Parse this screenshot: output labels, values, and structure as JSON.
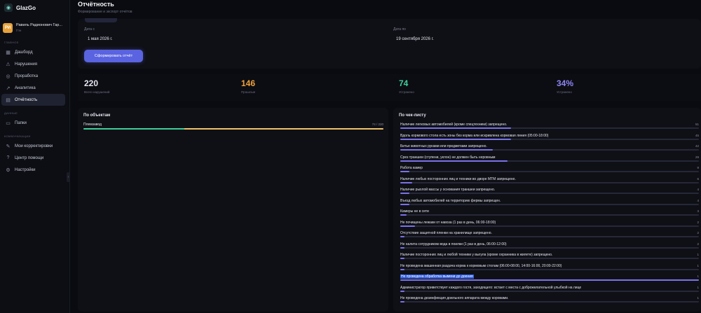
{
  "brand": {
    "name": "GlazGo",
    "logo_icon": "eye-logo-icon"
  },
  "user": {
    "initials": "РИ",
    "name": "Равиль Радионович Гар...",
    "role": "Гпн"
  },
  "sidebar": {
    "sections": [
      {
        "label": "ГЛАВНОЕ",
        "items": [
          {
            "label": "Дашборд",
            "icon": "grid-icon",
            "active": false
          },
          {
            "label": "Нарушения",
            "icon": "warning-icon",
            "active": false
          },
          {
            "label": "Проработка",
            "icon": "check-circle-icon",
            "active": false
          },
          {
            "label": "Аналитика",
            "icon": "chart-icon",
            "active": false
          },
          {
            "label": "Отчётность",
            "icon": "report-icon",
            "active": true
          }
        ]
      },
      {
        "label": "ДАННЫЕ",
        "items": [
          {
            "label": "Папки",
            "icon": "folder-icon",
            "active": false
          }
        ]
      },
      {
        "label": "КОММУНИКАЦИИ",
        "items": [
          {
            "label": "Мои корректировки",
            "icon": "edit-icon",
            "active": false
          },
          {
            "label": "Центр помощи",
            "icon": "help-icon",
            "active": false
          },
          {
            "label": "Настройки",
            "icon": "gear-icon",
            "active": false
          }
        ]
      }
    ]
  },
  "page": {
    "title": "Отчётность",
    "subtitle": "Формирование и экспорт отчётов"
  },
  "filters": {
    "from_label": "Дата с",
    "from_value": "1 мая 2026 г.",
    "to_label": "Дата по",
    "to_value": "19 сентября 2026 г.",
    "generate_button": "Сформировать отчёт"
  },
  "stats": [
    {
      "value": "220",
      "label": "Всего нарушений",
      "color": "#e4e6ef"
    },
    {
      "value": "146",
      "label": "Прошлые",
      "color": "#f0a23a"
    },
    {
      "value": "74",
      "label": "Устранено",
      "color": "#3ecf9a"
    },
    {
      "value": "34%",
      "label": "Устранено",
      "color": "#8e85f5"
    }
  ],
  "objects": {
    "title": "По объектам",
    "rows": [
      {
        "name": "Племзавод",
        "count": "74 / 220",
        "share_resolved": 0.336,
        "share_pending": 0.664
      }
    ]
  },
  "checklist": {
    "title": "По чек-листу",
    "rows": [
      {
        "text": "Наличие легковых автомобилей (кроме спецтехники) запрещено.",
        "count": "51",
        "fraction": 0.37
      },
      {
        "text": "Вдоль кормового стола есть зоны без корма или искривлена кормовая линия (05:00-18:00)",
        "count": "45",
        "fraction": 0.37
      },
      {
        "text": "Битье животных руками или предметами запрещено.",
        "count": "42",
        "fraction": 0.31
      },
      {
        "text": "Срез траншеи (ступени, уклон) не должен быть неровным",
        "count": "29",
        "fraction": 0.36
      },
      {
        "text": "Работа камер",
        "count": "9",
        "fraction": 0.03
      },
      {
        "text": "Наличие любых посторонних лиц и техники во дворе МТМ запрещено.",
        "count": "6",
        "fraction": 0.04
      },
      {
        "text": "Наличие рыхлой массы у основания траншеи запрещено.",
        "count": "4",
        "fraction": 0.03
      },
      {
        "text": "Въезд любых автомобилей на территорию фермы запрещен.",
        "count": "4",
        "fraction": 0.03
      },
      {
        "text": "Камеры не в сети",
        "count": "3",
        "fraction": 0.02
      },
      {
        "text": "Не почищены лежаки от навоза (1 раз в день, 06:00-18:00)",
        "count": "2",
        "fraction": 0.05
      },
      {
        "text": "Отсутствие защитной пленки на хранилище запрещено.",
        "count": "2",
        "fraction": 0.015
      },
      {
        "text": "Не налита сотрудником вода в поилки (1 раз в день, 06:00-12:00)",
        "count": "2",
        "fraction": 0.015
      },
      {
        "text": "Наличие посторонних лиц и любой техники у выгула (кроме охранника в жилете) запрещено.",
        "count": "1",
        "fraction": 0.015
      },
      {
        "text": "Не проведена машинная раздача корма к кормовым столам (06:00-08:00, 14:00-16:00, 20:00-22:00)",
        "count": "1",
        "fraction": 0.015
      },
      {
        "text": "Не проведена обработка вымени до доения",
        "count": "1",
        "fraction": 1.0,
        "highlight": true
      },
      {
        "text": "Администратор приветствует каждого гостя, заходящего: встает с места с доброжелательной улыбкой на лице",
        "count": "1",
        "fraction": 0.015
      },
      {
        "text": "Не проведена дезинфекция доильного аппарата между коровами.",
        "count": "1",
        "fraction": 0.015
      }
    ]
  },
  "colors": {
    "accent": "#5a63e0",
    "resolved": "#3ecf9a",
    "pending": "#f0c26a",
    "bar": "#7a72e8"
  }
}
